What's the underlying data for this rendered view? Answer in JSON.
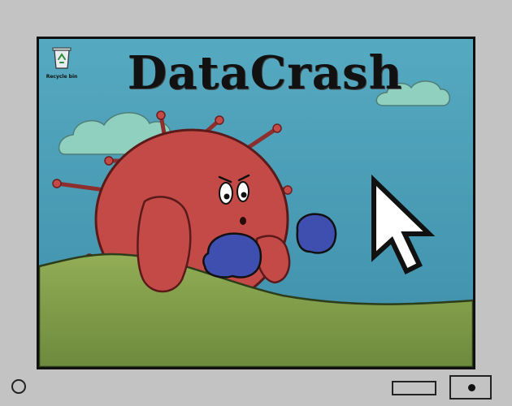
{
  "game": {
    "title": "DataCrash"
  },
  "desktop": {
    "recycle_bin_label": "Recycle bin"
  },
  "icons": {
    "recycle": "recycle-bin-icon",
    "cursor": "mouse-pointer-icon"
  },
  "colors": {
    "bezel": "#c3c3c3",
    "sky": "#5aaec2",
    "grass": "#8aa651",
    "virus": "#c44a47",
    "gloves": "#3e4fb0",
    "clouds": "#8fd1be"
  }
}
